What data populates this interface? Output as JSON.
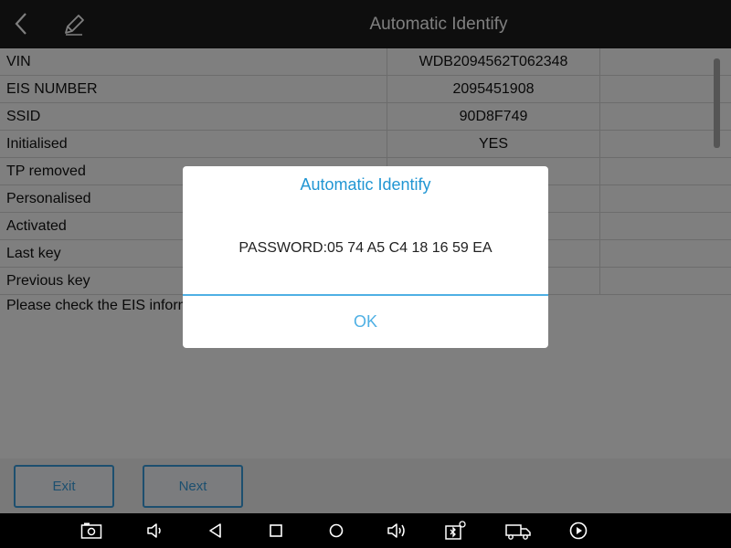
{
  "app": {
    "title": "Automatic Identify",
    "icons": {
      "back": "chevron-left-icon",
      "edit": "pencil-icon"
    }
  },
  "table": {
    "rows": [
      {
        "label": "VIN",
        "value": "WDB2094562T062348"
      },
      {
        "label": "EIS NUMBER",
        "value": "2095451908"
      },
      {
        "label": "SSID",
        "value": "90D8F749"
      },
      {
        "label": "Initialised",
        "value": "YES"
      },
      {
        "label": "TP removed",
        "value": ""
      },
      {
        "label": "Personalised",
        "value": ""
      },
      {
        "label": "Activated",
        "value": ""
      },
      {
        "label": "Last key",
        "value": ""
      },
      {
        "label": "Previous key",
        "value": ""
      }
    ],
    "message": "Please check the EIS inform"
  },
  "footer": {
    "exit_label": "Exit",
    "next_label": "Next"
  },
  "dialog": {
    "title": "Automatic Identify",
    "message": "PASSWORD:05 74 A5 C4 18 16 59 EA",
    "ok_label": "OK"
  },
  "navbar": {
    "icons": [
      "screenshot-icon",
      "volume-down-icon",
      "back-icon",
      "recents-icon",
      "home-icon",
      "volume-up-icon",
      "vci-icon",
      "truck-icon",
      "play-icon"
    ]
  },
  "colors": {
    "accent": "#2196d3",
    "topbar": "#1c1c1c",
    "navbar": "#000000",
    "button_border": "#3a9fdf"
  }
}
